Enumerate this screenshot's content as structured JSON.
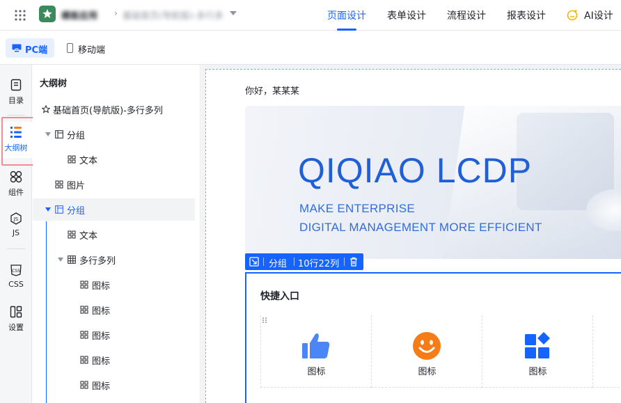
{
  "topbar": {
    "app_name": "模板应用",
    "page_name": "基础首页(导航版)-多行多列",
    "tabs": [
      {
        "label": "页面设计",
        "active": true
      },
      {
        "label": "表单设计",
        "active": false
      },
      {
        "label": "流程设计",
        "active": false
      },
      {
        "label": "报表设计",
        "active": false
      },
      {
        "label": "AI设计",
        "active": false
      }
    ]
  },
  "device_bar": {
    "pc_label": "PC端",
    "mobile_label": "移动端"
  },
  "rail": {
    "items": [
      {
        "label": "目录",
        "icon": "catalog-icon"
      },
      {
        "label": "大纲树",
        "icon": "outline-tree-icon",
        "active": true
      },
      {
        "label": "组件",
        "icon": "components-icon"
      },
      {
        "label": "JS",
        "icon": "js-icon"
      },
      {
        "label": "CSS",
        "icon": "css-icon"
      },
      {
        "label": "设置",
        "icon": "settings-icon"
      }
    ]
  },
  "tree": {
    "title": "大纲树",
    "rows": [
      {
        "label": "基础首页(导航版)-多行多列",
        "icon": "star-icon"
      },
      {
        "label": "分组",
        "icon": "group-icon"
      },
      {
        "label": "文本",
        "icon": "component-icon"
      },
      {
        "label": "图片",
        "icon": "component-icon"
      },
      {
        "label": "分组",
        "icon": "group-icon",
        "selected": true
      },
      {
        "label": "文本",
        "icon": "component-icon"
      },
      {
        "label": "多行多列",
        "icon": "table-icon"
      },
      {
        "label": "图标",
        "icon": "component-icon"
      },
      {
        "label": "图标",
        "icon": "component-icon"
      },
      {
        "label": "图标",
        "icon": "component-icon"
      },
      {
        "label": "图标",
        "icon": "component-icon"
      },
      {
        "label": "图标",
        "icon": "component-icon"
      }
    ]
  },
  "canvas": {
    "greeting": "你好，某某某",
    "banner": {
      "title": "QIQIAO LCDP",
      "line1": "MAKE ENTERPRISE",
      "line2": "DIGITAL MANAGEMENT MORE EFFICIENT"
    },
    "selection_bar": {
      "name": "分组",
      "size": "10行22列"
    },
    "quick": {
      "title": "快捷入口",
      "items": [
        {
          "label": "图标",
          "icon": "thumbs-up-icon",
          "color": "#4a86f5"
        },
        {
          "label": "图标",
          "icon": "smile-icon",
          "color": "#f57c16"
        },
        {
          "label": "图标",
          "icon": "apps-icon",
          "color": "#1664ff"
        }
      ]
    }
  },
  "colors": {
    "accent": "#1664ff",
    "highlight": "#f08a93"
  }
}
